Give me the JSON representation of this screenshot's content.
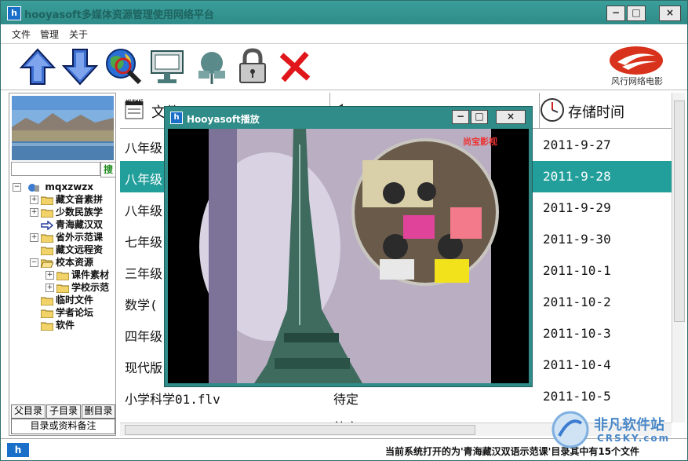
{
  "app": {
    "title": "hooyasoft多媒体资源管理使用网络平台",
    "icon_letter": "h",
    "window_buttons": {
      "minimize": "−",
      "maximize": "□",
      "close": "×"
    }
  },
  "menu": [
    "文件",
    "管理",
    "关于"
  ],
  "toolbar": {
    "tools": [
      "up-arrow-icon",
      "down-arrow-icon",
      "search-globe-icon",
      "monitor-icon",
      "network-icon",
      "lock-icon",
      "delete-x-icon"
    ],
    "logo_text": "风行网络电影"
  },
  "sidebar": {
    "search_label": "搜",
    "tree": [
      {
        "label": "mqxzwzx",
        "level": 0,
        "expander": "−",
        "type": "network"
      },
      {
        "label": "藏文音素拼",
        "level": 1,
        "expander": "+",
        "type": "folder"
      },
      {
        "label": "少数民族学",
        "level": 1,
        "expander": "+",
        "type": "folder"
      },
      {
        "label": "青海藏汉双",
        "level": 1,
        "expander": "",
        "type": "arrow"
      },
      {
        "label": "省外示范课",
        "level": 1,
        "expander": "+",
        "type": "folder"
      },
      {
        "label": "藏文远程资",
        "level": 1,
        "expander": "",
        "type": "folder"
      },
      {
        "label": "校本资源",
        "level": 1,
        "expander": "−",
        "type": "folder"
      },
      {
        "label": "课件素材",
        "level": 2,
        "expander": "+",
        "type": "folder"
      },
      {
        "label": "学校示范",
        "level": 2,
        "expander": "+",
        "type": "folder"
      },
      {
        "label": "临时文件",
        "level": 1,
        "expander": "",
        "type": "folder"
      },
      {
        "label": "学者论坛",
        "level": 1,
        "expander": "",
        "type": "folder"
      },
      {
        "label": "软件",
        "level": 1,
        "expander": "",
        "type": "folder"
      }
    ],
    "dir_buttons": [
      "父目录",
      "子目录",
      "删目录"
    ],
    "note": "目录或资料备注"
  },
  "list": {
    "headers": {
      "name": "文件",
      "status": "",
      "time": "存储时间"
    },
    "header_icon_memo": "MEMO",
    "rows": [
      {
        "name": "八年级",
        "status": "",
        "time": "2011-9-27"
      },
      {
        "name": "八年级",
        "status": "",
        "time": "2011-9-28"
      },
      {
        "name": "八年级",
        "status": "",
        "time": "2011-9-29"
      },
      {
        "name": "七年级",
        "status": "",
        "time": "2011-9-30"
      },
      {
        "name": "三年级",
        "status": "",
        "time": "2011-10-1"
      },
      {
        "name": "数学(",
        "status": "",
        "time": "2011-10-2"
      },
      {
        "name": "四年级",
        "status": "",
        "time": "2011-10-3"
      },
      {
        "name": "现代版",
        "status": "",
        "time": "2011-10-4"
      },
      {
        "name": "小学科学01.flv",
        "status": "待定",
        "time": "2011-10-5"
      },
      {
        "name": "",
        "status": "待定",
        "time": ""
      }
    ],
    "selected_index": 1
  },
  "player": {
    "title": "Hooyasoft播放",
    "caption": "尚宝影视"
  },
  "status": {
    "text": "当前系统打开的为'青海藏汉双语示范课'目录其中有15个文件"
  },
  "watermark": {
    "line1": "非凡软件站",
    "line2": "CRSKY.com"
  },
  "colors": {
    "accent": "#2f8c88",
    "selected": "#239f9b"
  }
}
